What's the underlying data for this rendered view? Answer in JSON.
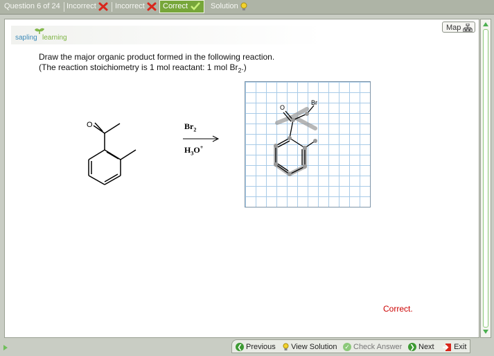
{
  "topbar": {
    "question_counter": "Question 6 of 24",
    "attempts": [
      {
        "label": "Incorrect",
        "status": "incorrect"
      },
      {
        "label": "Incorrect",
        "status": "incorrect"
      },
      {
        "label": "Correct",
        "status": "correct"
      }
    ],
    "solution_label": "Solution"
  },
  "logo": {
    "part1": "sapling",
    "part2": "learning"
  },
  "map_label": "Map",
  "question": {
    "line1": "Draw the major organic product formed in the following reaction.",
    "line2_prefix": "(The reaction stoichiometry is 1 mol reactant: 1 mol Br",
    "line2_sub": "2",
    "line2_suffix": ".)"
  },
  "reaction": {
    "reactant_atom": "O",
    "reagent_top_base": "Br",
    "reagent_top_sub": "2",
    "reagent_bottom_H": "H",
    "reagent_bottom_sub": "3",
    "reagent_bottom_O": "O",
    "reagent_bottom_sup": "+"
  },
  "canvas": {
    "atom_O": "O",
    "atom_Br": "Br"
  },
  "feedback": "Correct.",
  "bottom_nav": {
    "previous": "Previous",
    "view_solution": "View Solution",
    "check_answer": "Check Answer",
    "next": "Next",
    "exit": "Exit"
  },
  "colors": {
    "correct_green": "#77a63a",
    "incorrect_red": "#d9261c",
    "feedback_red": "#cc0000",
    "grid_blue": "#a8cbe8"
  }
}
